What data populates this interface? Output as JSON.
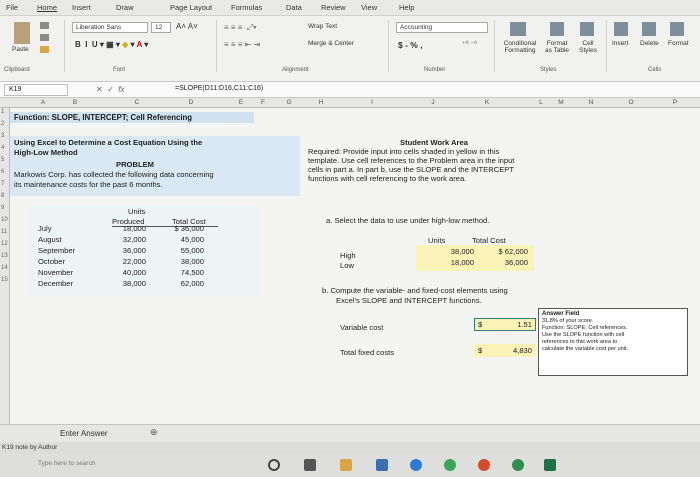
{
  "ribbon": {
    "tabs": [
      "File",
      "Home",
      "Insert",
      "Draw",
      "Page Layout",
      "Formulas",
      "Data",
      "Review",
      "View",
      "Help"
    ],
    "font_name": "Liberation Sans",
    "font_size": "12",
    "wrap_text": "Wrap Text",
    "merge_center": "Merge & Center",
    "number_format": "Accounting",
    "currency": "$ - % ,",
    "conditional_formatting": "Conditional Formatting",
    "format_as_table": "Format as Table",
    "cell_styles": "Cell Styles",
    "insert": "Insert",
    "delete": "Delete",
    "format": "Format",
    "paste": "Paste",
    "groups": [
      "Clipboard",
      "Font",
      "Alignment",
      "Number",
      "Styles",
      "Cells"
    ]
  },
  "formula_bar": {
    "name_box": "K19",
    "formula": "=SLOPE(D11:D16,C11:C16)"
  },
  "columns": [
    "A",
    "B",
    "C",
    "D",
    "E",
    "F",
    "G",
    "H",
    "I",
    "J",
    "K",
    "L",
    "M",
    "N",
    "O",
    "P"
  ],
  "rows": [
    "1",
    "2",
    "3",
    "4",
    "5",
    "6",
    "7",
    "8",
    "9",
    "10",
    "11",
    "12",
    "13",
    "14",
    "15"
  ],
  "sheet": {
    "title": "Function: SLOPE, INTERCEPT; Cell Referencing",
    "heading1": "Using Excel to Determine a Cost Equation Using the",
    "heading2": "High-Low Method",
    "problem_label": "PROBLEM",
    "problem_text1": "Markowis Corp. has collected the following data concerning",
    "problem_text2": "its maintenance costs for the past 6 months.",
    "wa_title": "Student Work Area",
    "wa_line1": "Required: Provide input into cells shaded in yellow in this",
    "wa_line2": "template. Use cell references to the Problem area in the input",
    "wa_line3": "cells in part a. In part b, use the SLOPE and the INTERCEPT",
    "wa_line4": "functions with cell referencing to the work area.",
    "units_label": "Units",
    "produced_label": "Produced",
    "total_cost_label": "Total Cost",
    "months": [
      {
        "month": "July",
        "units": "18,000",
        "cost": "$ 36,000"
      },
      {
        "month": "August",
        "units": "32,000",
        "cost": "45,000"
      },
      {
        "month": "September",
        "units": "36,000",
        "cost": "55,000"
      },
      {
        "month": "October",
        "units": "22,000",
        "cost": "38,000"
      },
      {
        "month": "November",
        "units": "40,000",
        "cost": "74,500"
      },
      {
        "month": "December",
        "units": "38,000",
        "cost": "62,000"
      }
    ],
    "part_a": "a. Select the data to use under high-low method.",
    "hl_units": "Units",
    "hl_cost": "Total Cost",
    "high": "High",
    "low": "Low",
    "high_units": "38,000",
    "high_cost": "$  62,000",
    "low_units": "18,000",
    "low_cost": "36,000",
    "part_b1": "b. Compute the variable- and fixed-cost elements using",
    "part_b2": "Excel's SLOPE and INTERCEPT functions.",
    "variable_cost_label": "Variable cost",
    "variable_cost_currency": "$",
    "variable_cost_value": "1.51",
    "fixed_cost_label": "Total fixed costs",
    "fixed_cost_currency": "$",
    "fixed_cost_value": "4,830",
    "answer_title": "Answer Field",
    "answer_line1": "31.8% of your score.",
    "answer_line2": "Function: SLOPE; Cell references.",
    "answer_line3": "Use the SLOPE function with cell",
    "answer_line4": "references to this work area to",
    "answer_line5": "calculate the variable cost per unit."
  },
  "footer": {
    "enter_answer": "Enter Answer",
    "note": "K19 note by Author",
    "search": "Type here to search"
  }
}
